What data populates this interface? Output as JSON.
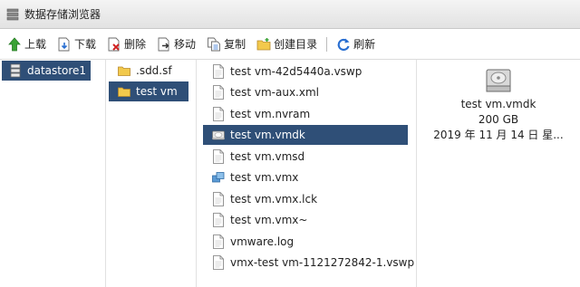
{
  "window": {
    "title": "数据存储浏览器"
  },
  "toolbar": {
    "upload": "上载",
    "download": "下载",
    "delete": "删除",
    "move": "移动",
    "copy": "复制",
    "create_dir": "创建目录",
    "refresh": "刷新"
  },
  "datastores": [
    {
      "label": "datastore1",
      "selected": true
    }
  ],
  "folders": [
    {
      "label": ".sdd.sf",
      "selected": false
    },
    {
      "label": "test vm",
      "selected": true
    }
  ],
  "files": [
    {
      "label": "test vm-42d5440a.vswp",
      "icon": "file-icon",
      "selected": false
    },
    {
      "label": "test vm-aux.xml",
      "icon": "file-icon",
      "selected": false
    },
    {
      "label": "test vm.nvram",
      "icon": "file-icon",
      "selected": false
    },
    {
      "label": "test vm.vmdk",
      "icon": "disk-icon",
      "selected": true
    },
    {
      "label": "test vm.vmsd",
      "icon": "file-icon",
      "selected": false
    },
    {
      "label": "test vm.vmx",
      "icon": "vm-icon",
      "selected": false
    },
    {
      "label": "test vm.vmx.lck",
      "icon": "file-icon",
      "selected": false
    },
    {
      "label": "test vm.vmx~",
      "icon": "file-icon",
      "selected": false
    },
    {
      "label": "vmware.log",
      "icon": "file-icon",
      "selected": false
    },
    {
      "label": "vmx-test vm-1121272842-1.vswp",
      "icon": "file-icon",
      "selected": false
    }
  ],
  "details": {
    "name": "test vm.vmdk",
    "size": "200 GB",
    "date": "2019 年 11 月 14 日 星..."
  },
  "colors": {
    "selection": "#2f4f77",
    "accent_green": "#3aa335",
    "refresh_blue": "#2a6fd1"
  }
}
